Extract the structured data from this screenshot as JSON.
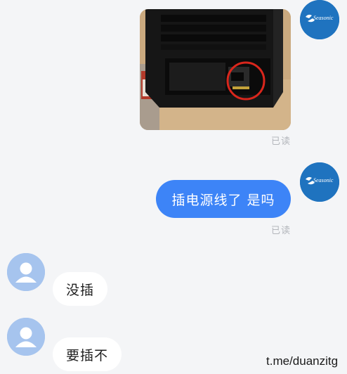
{
  "contact_avatar": {
    "icon": "seasonic-logo",
    "brand_text": "Seasonic",
    "bg_color": "#1f73bf"
  },
  "user_avatar": {
    "icon": "person-icon",
    "bg_color": "#a6c4ee"
  },
  "messages": [
    {
      "direction": "outgoing",
      "kind": "image",
      "description_icon": "pc-case-power-socket-photo",
      "read_status": "已读"
    },
    {
      "direction": "outgoing",
      "kind": "text",
      "text": "插电源线了 是吗",
      "read_status": "已读"
    },
    {
      "direction": "incoming",
      "kind": "text",
      "text": "没插"
    },
    {
      "direction": "incoming",
      "kind": "text",
      "text": "要插不"
    }
  ],
  "colors": {
    "background": "#f4f5f7",
    "outgoing_bubble": "#3d84f7",
    "incoming_bubble": "#ffffff",
    "read_text": "#b3b6bb"
  },
  "watermark": "t.me/duanzitg"
}
